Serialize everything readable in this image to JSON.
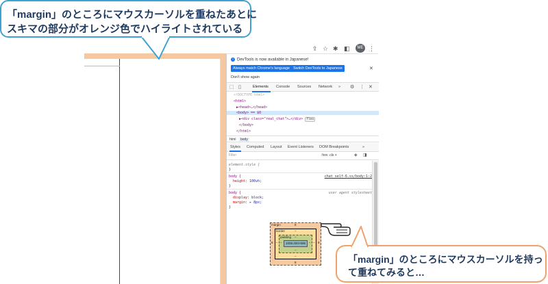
{
  "callout_top": {
    "line1": "「margin」のところにマウスカーソルを重ねたあとに",
    "line2": "スキマの部分がオレンジ色でハイライトされている"
  },
  "callout_bottom": {
    "line1": "「margin」のところにマウスカーソルを持っ",
    "line2": "て重ねてみると…"
  },
  "chrome": {
    "avatar_text": "ME"
  },
  "devtools": {
    "notice": "DevTools is now available in Japanese!",
    "match_language_button": "Always match Chrome's language",
    "switch_japanese_button": "Switch DevTools to Japanese",
    "dont_show": "Don't show again",
    "tabs": [
      "Elements",
      "Console",
      "Sources",
      "Network"
    ],
    "more_tabs": "»",
    "tree": {
      "doctype": "<!DOCTYPE html>",
      "html_open": "<html>",
      "head": "▶<head>…</head>",
      "body_open": "<body> == $0",
      "div": "▶<div class=\"real_chat\">…</div>",
      "flex_badge": "flex",
      "body_close": "</body>",
      "html_close": "</html>"
    },
    "breadcrumbs": [
      "html",
      "body"
    ],
    "styles_tabs": [
      "Styles",
      "Computed",
      "Layout",
      "Event Listeners",
      "DOM Breakpoints"
    ],
    "filter_placeholder": "Filter",
    "filter_tools": ":hov  .cls  +",
    "rules": {
      "element_style": "element.style {",
      "element_style_close": "}",
      "body1_selector": "body {",
      "body1_source": "chat_self-6.ss/body:1:2",
      "body1_prop": "height",
      "body1_val": "100vh;",
      "body1_close": "}",
      "body2_selector": "body {",
      "body2_source": "user agent stylesheet",
      "body2_prop1": "display",
      "body2_val1": "block;",
      "body2_prop2": "margin",
      "body2_val2": "▸ 8px;",
      "body2_close": "}"
    },
    "box_model": {
      "margin_label": "margin",
      "margin_top": "8",
      "margin_bottom": "8",
      "margin_left": "8",
      "margin_right": "8",
      "border_label": "border",
      "border_top": "–",
      "border_bottom": "–",
      "border_left": "–",
      "border_right": "–",
      "padding_label": "padding",
      "padding_top": "–",
      "padding_bottom": "–",
      "padding_left": "–",
      "padding_right": "–",
      "content": "1008.400×696"
    }
  }
}
